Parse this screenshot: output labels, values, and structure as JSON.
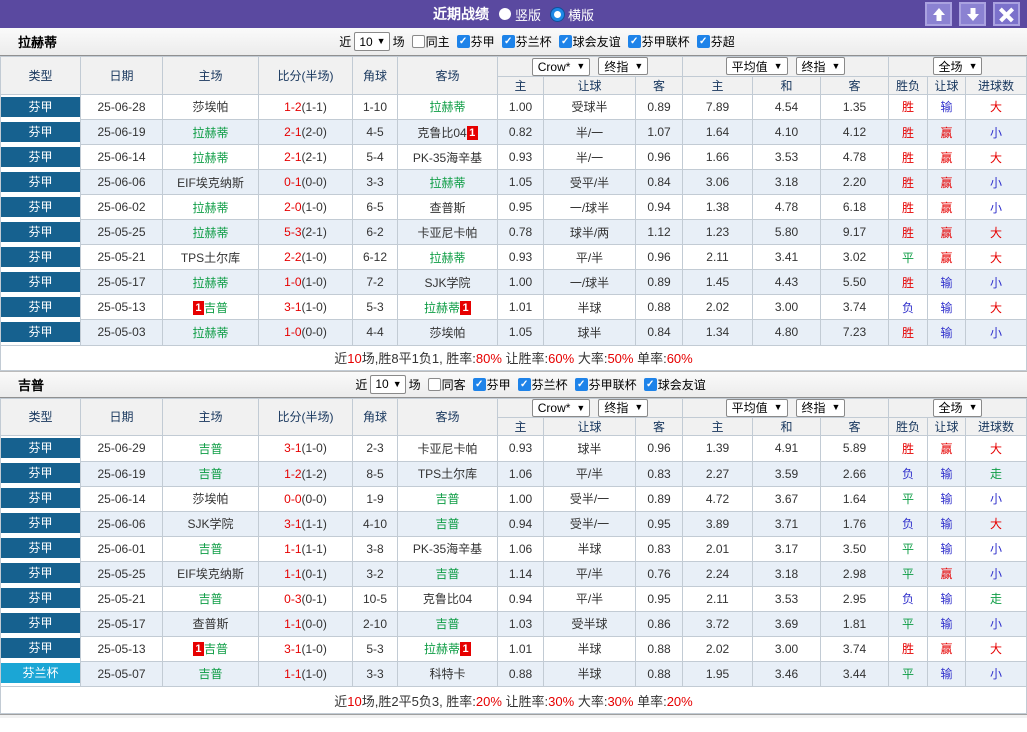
{
  "titlebar": {
    "title": "近期战绩",
    "radio_vertical": "竖版",
    "radio_horizontal": "横版",
    "buttons": {
      "up": "up-arrow",
      "down": "down-arrow",
      "close": "close-x"
    }
  },
  "colors": {
    "topbar": "#5a49a0",
    "league_cell": "#16618f",
    "cup_cell": "#1ba6d5",
    "team_green": "#0e9d45",
    "score_red": "#e60000",
    "loss_blue": "#3030cc",
    "checkbox_blue": "#1e83e9"
  },
  "table_header": {
    "left_cols": [
      "类型",
      "日期",
      "主场",
      "比分(半场)",
      "角球",
      "客场"
    ],
    "right_cols": [
      "主",
      "让球",
      "客",
      "主",
      "和",
      "客",
      "胜负",
      "让球",
      "进球数"
    ],
    "group1_selects": [
      "Crow*",
      "终指"
    ],
    "group2_selects": [
      "平均值",
      "终指"
    ],
    "group3_selects": [
      "全场"
    ]
  },
  "sections": [
    {
      "team": "拉赫蒂",
      "filter": {
        "prefix": "近",
        "count": "10",
        "suffix": "场",
        "unchecked": [
          "同主"
        ],
        "checked": [
          "芬甲",
          "芬兰杯",
          "球会友谊",
          "芬甲联杯",
          "芬超"
        ]
      },
      "rows": [
        {
          "type": "芬甲",
          "cup": false,
          "date": "25-06-28",
          "home": {
            "name": "莎埃帕",
            "green": false
          },
          "score": "1-2",
          "half": "(1-1)",
          "corner": "1-10",
          "away": {
            "name": "拉赫蒂",
            "green": true
          },
          "odds": [
            "1.00",
            "受球半",
            "0.89",
            "7.89",
            "4.54",
            "1.35"
          ],
          "res": [
            [
              "胜",
              "r"
            ],
            [
              "输",
              "b"
            ],
            [
              "大",
              "r"
            ]
          ]
        },
        {
          "type": "芬甲",
          "cup": false,
          "date": "25-06-19",
          "home": {
            "name": "拉赫蒂",
            "green": true
          },
          "score": "2-1",
          "half": "(2-0)",
          "corner": "4-5",
          "away": {
            "name": "克鲁比04",
            "green": false,
            "badge_after": "1"
          },
          "odds": [
            "0.82",
            "半/一",
            "1.07",
            "1.64",
            "4.10",
            "4.12"
          ],
          "res": [
            [
              "胜",
              "r"
            ],
            [
              "赢",
              "r"
            ],
            [
              "小",
              "b"
            ]
          ]
        },
        {
          "type": "芬甲",
          "cup": false,
          "date": "25-06-14",
          "home": {
            "name": "拉赫蒂",
            "green": true
          },
          "score": "2-1",
          "half": "(2-1)",
          "corner": "5-4",
          "away": {
            "name": "PK-35海辛基",
            "green": false
          },
          "odds": [
            "0.93",
            "半/一",
            "0.96",
            "1.66",
            "3.53",
            "4.78"
          ],
          "res": [
            [
              "胜",
              "r"
            ],
            [
              "赢",
              "r"
            ],
            [
              "大",
              "r"
            ]
          ]
        },
        {
          "type": "芬甲",
          "cup": false,
          "date": "25-06-06",
          "home": {
            "name": "EIF埃克纳斯",
            "green": false
          },
          "score": "0-1",
          "half": "(0-0)",
          "corner": "3-3",
          "away": {
            "name": "拉赫蒂",
            "green": true
          },
          "odds": [
            "1.05",
            "受平/半",
            "0.84",
            "3.06",
            "3.18",
            "2.20"
          ],
          "res": [
            [
              "胜",
              "r"
            ],
            [
              "赢",
              "r"
            ],
            [
              "小",
              "b"
            ]
          ]
        },
        {
          "type": "芬甲",
          "cup": false,
          "date": "25-06-02",
          "home": {
            "name": "拉赫蒂",
            "green": true
          },
          "score": "2-0",
          "half": "(1-0)",
          "corner": "6-5",
          "away": {
            "name": "查普斯",
            "green": false
          },
          "odds": [
            "0.95",
            "一/球半",
            "0.94",
            "1.38",
            "4.78",
            "6.18"
          ],
          "res": [
            [
              "胜",
              "r"
            ],
            [
              "赢",
              "r"
            ],
            [
              "小",
              "b"
            ]
          ]
        },
        {
          "type": "芬甲",
          "cup": false,
          "date": "25-05-25",
          "home": {
            "name": "拉赫蒂",
            "green": true
          },
          "score": "5-3",
          "half": "(2-1)",
          "corner": "6-2",
          "away": {
            "name": "卡亚尼卡帕",
            "green": false
          },
          "odds": [
            "0.78",
            "球半/两",
            "1.12",
            "1.23",
            "5.80",
            "9.17"
          ],
          "res": [
            [
              "胜",
              "r"
            ],
            [
              "赢",
              "r"
            ],
            [
              "大",
              "r"
            ]
          ]
        },
        {
          "type": "芬甲",
          "cup": false,
          "date": "25-05-21",
          "home": {
            "name": "TPS土尔库",
            "green": false
          },
          "score": "2-2",
          "half": "(1-0)",
          "corner": "6-12",
          "away": {
            "name": "拉赫蒂",
            "green": true
          },
          "odds": [
            "0.93",
            "平/半",
            "0.96",
            "2.11",
            "3.41",
            "3.02"
          ],
          "res": [
            [
              "平",
              "g"
            ],
            [
              "赢",
              "r"
            ],
            [
              "大",
              "r"
            ]
          ]
        },
        {
          "type": "芬甲",
          "cup": false,
          "date": "25-05-17",
          "home": {
            "name": "拉赫蒂",
            "green": true
          },
          "score": "1-0",
          "half": "(1-0)",
          "corner": "7-2",
          "away": {
            "name": "SJK学院",
            "green": false
          },
          "odds": [
            "1.00",
            "一/球半",
            "0.89",
            "1.45",
            "4.43",
            "5.50"
          ],
          "res": [
            [
              "胜",
              "r"
            ],
            [
              "输",
              "b"
            ],
            [
              "小",
              "b"
            ]
          ]
        },
        {
          "type": "芬甲",
          "cup": false,
          "date": "25-05-13",
          "home": {
            "name": "吉普",
            "green": true,
            "badge_before": "1"
          },
          "score": "3-1",
          "half": "(1-0)",
          "corner": "5-3",
          "away": {
            "name": "拉赫蒂",
            "green": true,
            "badge_after": "1"
          },
          "odds": [
            "1.01",
            "半球",
            "0.88",
            "2.02",
            "3.00",
            "3.74"
          ],
          "res": [
            [
              "负",
              "b"
            ],
            [
              "输",
              "b"
            ],
            [
              "大",
              "r"
            ]
          ]
        },
        {
          "type": "芬甲",
          "cup": false,
          "date": "25-05-03",
          "home": {
            "name": "拉赫蒂",
            "green": true
          },
          "score": "1-0",
          "half": "(0-0)",
          "corner": "4-4",
          "away": {
            "name": "莎埃帕",
            "green": false
          },
          "odds": [
            "1.05",
            "球半",
            "0.84",
            "1.34",
            "4.80",
            "7.23"
          ],
          "res": [
            [
              "胜",
              "r"
            ],
            [
              "输",
              "b"
            ],
            [
              "小",
              "b"
            ]
          ]
        }
      ],
      "summary": [
        [
          "近",
          "k"
        ],
        [
          "10",
          "r"
        ],
        [
          "场,胜8平1负1, 胜率:",
          "k"
        ],
        [
          "80%",
          "r"
        ],
        [
          " 让胜率:",
          "k"
        ],
        [
          "60%",
          "r"
        ],
        [
          " 大率:",
          "k"
        ],
        [
          "50%",
          "r"
        ],
        [
          " 单率:",
          "k"
        ],
        [
          "60%",
          "r"
        ]
      ]
    },
    {
      "team": "吉普",
      "filter": {
        "prefix": "近",
        "count": "10",
        "suffix": "场",
        "unchecked": [
          "同客"
        ],
        "checked": [
          "芬甲",
          "芬兰杯",
          "芬甲联杯",
          "球会友谊"
        ]
      },
      "rows": [
        {
          "type": "芬甲",
          "cup": false,
          "date": "25-06-29",
          "home": {
            "name": "吉普",
            "green": true
          },
          "score": "3-1",
          "half": "(1-0)",
          "corner": "2-3",
          "away": {
            "name": "卡亚尼卡帕",
            "green": false
          },
          "odds": [
            "0.93",
            "球半",
            "0.96",
            "1.39",
            "4.91",
            "5.89"
          ],
          "res": [
            [
              "胜",
              "r"
            ],
            [
              "赢",
              "r"
            ],
            [
              "大",
              "r"
            ]
          ]
        },
        {
          "type": "芬甲",
          "cup": false,
          "date": "25-06-19",
          "home": {
            "name": "吉普",
            "green": true
          },
          "score": "1-2",
          "half": "(1-2)",
          "corner": "8-5",
          "away": {
            "name": "TPS土尔库",
            "green": false
          },
          "odds": [
            "1.06",
            "平/半",
            "0.83",
            "2.27",
            "3.59",
            "2.66"
          ],
          "res": [
            [
              "负",
              "b"
            ],
            [
              "输",
              "b"
            ],
            [
              "走",
              "g"
            ]
          ]
        },
        {
          "type": "芬甲",
          "cup": false,
          "date": "25-06-14",
          "home": {
            "name": "莎埃帕",
            "green": false
          },
          "score": "0-0",
          "half": "(0-0)",
          "corner": "1-9",
          "away": {
            "name": "吉普",
            "green": true
          },
          "odds": [
            "1.00",
            "受半/一",
            "0.89",
            "4.72",
            "3.67",
            "1.64"
          ],
          "res": [
            [
              "平",
              "g"
            ],
            [
              "输",
              "b"
            ],
            [
              "小",
              "b"
            ]
          ]
        },
        {
          "type": "芬甲",
          "cup": false,
          "date": "25-06-06",
          "home": {
            "name": "SJK学院",
            "green": false
          },
          "score": "3-1",
          "half": "(1-1)",
          "corner": "4-10",
          "away": {
            "name": "吉普",
            "green": true
          },
          "odds": [
            "0.94",
            "受半/一",
            "0.95",
            "3.89",
            "3.71",
            "1.76"
          ],
          "res": [
            [
              "负",
              "b"
            ],
            [
              "输",
              "b"
            ],
            [
              "大",
              "r"
            ]
          ]
        },
        {
          "type": "芬甲",
          "cup": false,
          "date": "25-06-01",
          "home": {
            "name": "吉普",
            "green": true
          },
          "score": "1-1",
          "half": "(1-1)",
          "corner": "3-8",
          "away": {
            "name": "PK-35海辛基",
            "green": false
          },
          "odds": [
            "1.06",
            "半球",
            "0.83",
            "2.01",
            "3.17",
            "3.50"
          ],
          "res": [
            [
              "平",
              "g"
            ],
            [
              "输",
              "b"
            ],
            [
              "小",
              "b"
            ]
          ]
        },
        {
          "type": "芬甲",
          "cup": false,
          "date": "25-05-25",
          "home": {
            "name": "EIF埃克纳斯",
            "green": false
          },
          "score": "1-1",
          "half": "(0-1)",
          "corner": "3-2",
          "away": {
            "name": "吉普",
            "green": true
          },
          "odds": [
            "1.14",
            "平/半",
            "0.76",
            "2.24",
            "3.18",
            "2.98"
          ],
          "res": [
            [
              "平",
              "g"
            ],
            [
              "赢",
              "r"
            ],
            [
              "小",
              "b"
            ]
          ]
        },
        {
          "type": "芬甲",
          "cup": false,
          "date": "25-05-21",
          "home": {
            "name": "吉普",
            "green": true
          },
          "score": "0-3",
          "half": "(0-1)",
          "corner": "10-5",
          "away": {
            "name": "克鲁比04",
            "green": false
          },
          "odds": [
            "0.94",
            "平/半",
            "0.95",
            "2.11",
            "3.53",
            "2.95"
          ],
          "res": [
            [
              "负",
              "b"
            ],
            [
              "输",
              "b"
            ],
            [
              "走",
              "g"
            ]
          ]
        },
        {
          "type": "芬甲",
          "cup": false,
          "date": "25-05-17",
          "home": {
            "name": "查普斯",
            "green": false
          },
          "score": "1-1",
          "half": "(0-0)",
          "corner": "2-10",
          "away": {
            "name": "吉普",
            "green": true
          },
          "odds": [
            "1.03",
            "受半球",
            "0.86",
            "3.72",
            "3.69",
            "1.81"
          ],
          "res": [
            [
              "平",
              "g"
            ],
            [
              "输",
              "b"
            ],
            [
              "小",
              "b"
            ]
          ]
        },
        {
          "type": "芬甲",
          "cup": false,
          "date": "25-05-13",
          "home": {
            "name": "吉普",
            "green": true,
            "badge_before": "1"
          },
          "score": "3-1",
          "half": "(1-0)",
          "corner": "5-3",
          "away": {
            "name": "拉赫蒂",
            "green": true,
            "badge_after": "1"
          },
          "odds": [
            "1.01",
            "半球",
            "0.88",
            "2.02",
            "3.00",
            "3.74"
          ],
          "res": [
            [
              "胜",
              "r"
            ],
            [
              "赢",
              "r"
            ],
            [
              "大",
              "r"
            ]
          ]
        },
        {
          "type": "芬兰杯",
          "cup": true,
          "date": "25-05-07",
          "home": {
            "name": "吉普",
            "green": true
          },
          "score": "1-1",
          "half": "(1-0)",
          "corner": "3-3",
          "away": {
            "name": "科特卡",
            "green": false
          },
          "odds": [
            "0.88",
            "半球",
            "0.88",
            "1.95",
            "3.46",
            "3.44"
          ],
          "res": [
            [
              "平",
              "g"
            ],
            [
              "输",
              "b"
            ],
            [
              "小",
              "b"
            ]
          ]
        }
      ],
      "summary": [
        [
          "近",
          "k"
        ],
        [
          "10",
          "r"
        ],
        [
          "场,胜2平5负3, 胜率:",
          "k"
        ],
        [
          "20%",
          "r"
        ],
        [
          " 让胜率:",
          "k"
        ],
        [
          "30%",
          "r"
        ],
        [
          " 大率:",
          "k"
        ],
        [
          "30%",
          "r"
        ],
        [
          " 单率:",
          "k"
        ],
        [
          "20%",
          "r"
        ]
      ]
    }
  ]
}
